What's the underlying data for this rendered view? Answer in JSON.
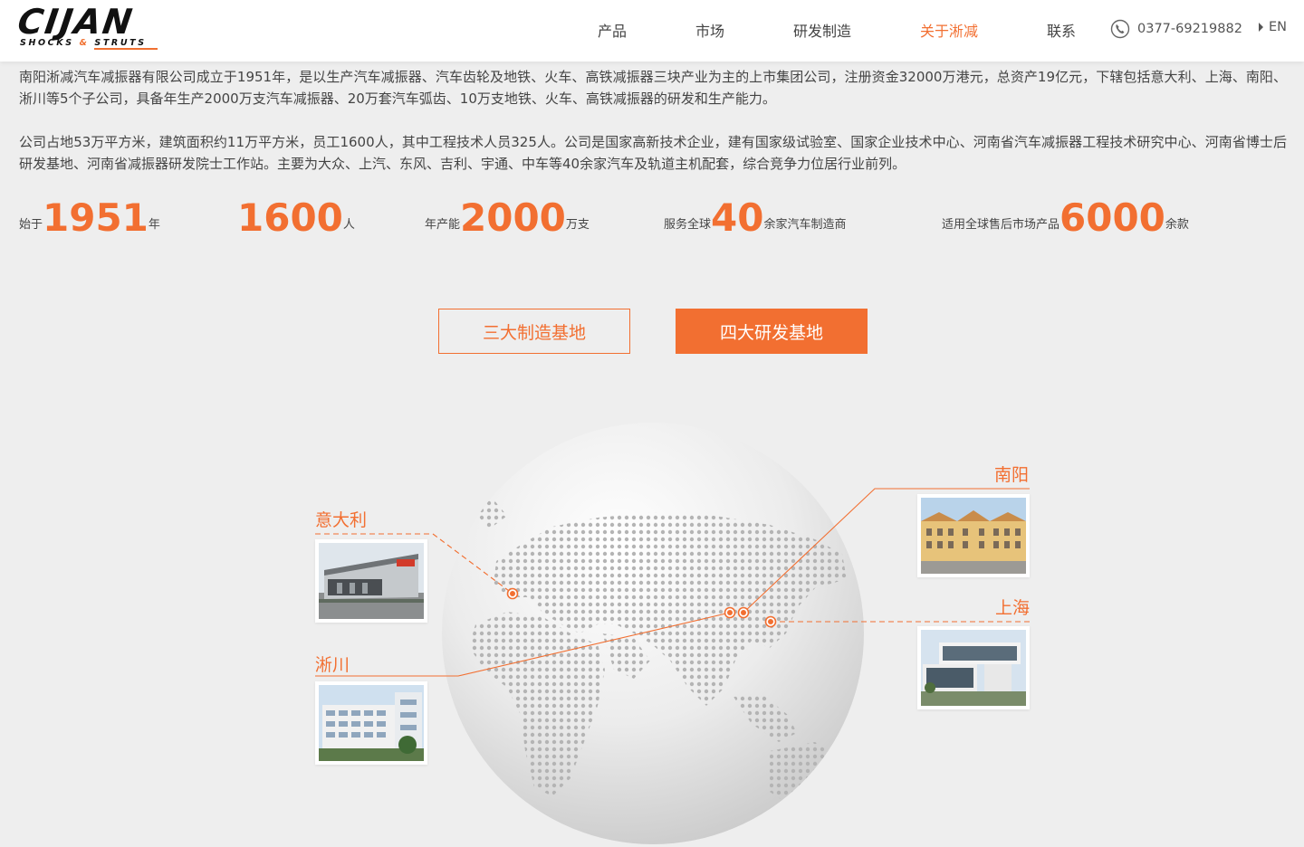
{
  "header": {
    "logo_main": "CIJAN",
    "logo_sub_left": "SHOCKS",
    "logo_sub_amp": "&",
    "logo_sub_right": "STRUTS",
    "nav": [
      {
        "label": "产品",
        "active": false
      },
      {
        "label": "市场",
        "active": false
      },
      {
        "label": "研发制造",
        "active": false
      },
      {
        "label": "关于淅减",
        "active": true
      },
      {
        "label": "联系",
        "active": false
      }
    ],
    "phone": "0377-69219882",
    "lang": "EN"
  },
  "intro": {
    "p1": "南阳淅减汽车减振器有限公司成立于1951年，是以生产汽车减振器、汽车齿轮及地铁、火车、高铁减振器三块产业为主的上市集团公司，注册资金32000万港元，总资产19亿元，下辖包括意大利、上海、南阳、淅川等5个子公司，具备年生产2000万支汽车减振器、20万套汽车弧齿、10万支地铁、火车、高铁减振器的研发和生产能力。",
    "p2": "公司占地53万平方米，建筑面积约11万平方米，员工1600人，其中工程技术人员325人。公司是国家高新技术企业，建有国家级试验室、国家企业技术中心、河南省汽车减振器工程技术研究中心、河南省博士后研发基地、河南省减振器研发院士工作站。主要为大众、上汽、东风、吉利、宇通、中车等40余家汽车及轨道主机配套，综合竞争力位居行业前列。"
  },
  "stats": [
    {
      "prefix": "始于",
      "value": "1951",
      "suffix": "年"
    },
    {
      "prefix": "",
      "value": "1600",
      "suffix": "人"
    },
    {
      "prefix": "年产能",
      "value": "2000",
      "suffix": "万支"
    },
    {
      "prefix": "服务全球",
      "value": "40",
      "suffix": "余家汽车制造商"
    },
    {
      "prefix": "适用全球售后市场产品",
      "value": "6000",
      "suffix": "余款"
    }
  ],
  "tabs": [
    {
      "label": "三大制造基地",
      "active": false
    },
    {
      "label": "四大研发基地",
      "active": true
    }
  ],
  "locations": {
    "italy": "意大利",
    "xichuan": "淅川",
    "nanyang": "南阳",
    "shanghai": "上海"
  },
  "colors": {
    "accent": "#f26f31",
    "background": "#eeeeee",
    "header": "#ffffff",
    "text": "#444444"
  },
  "icons": {
    "phone": "phone-icon",
    "lang": "triangle-right-icon"
  }
}
